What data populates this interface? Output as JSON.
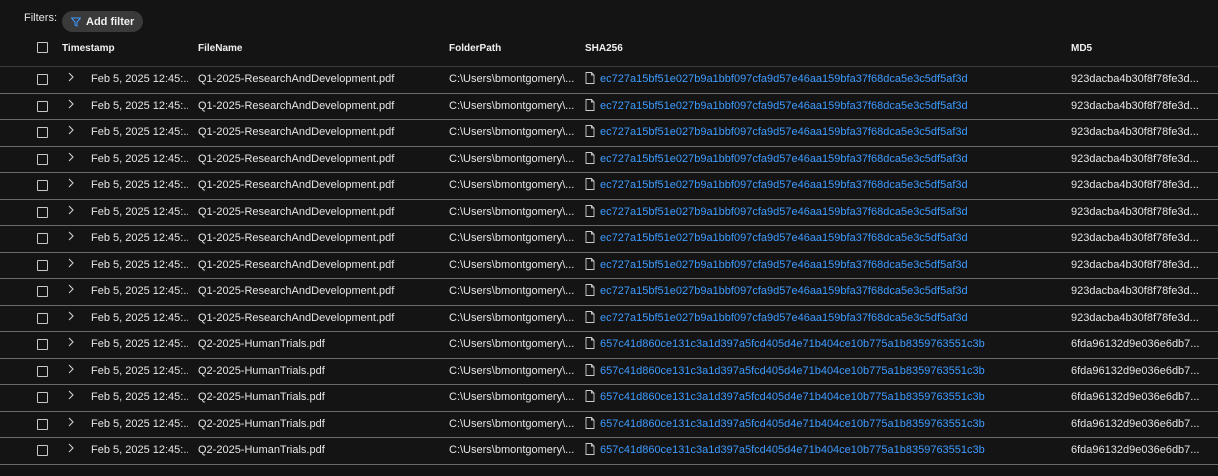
{
  "filters": {
    "label": "Filters:",
    "add_filter_label": "Add filter"
  },
  "columns": {
    "timestamp": "Timestamp",
    "filename": "FileName",
    "folderpath": "FolderPath",
    "sha256": "SHA256",
    "md5": "MD5"
  },
  "rows": [
    {
      "timestamp": "Feb 5, 2025 12:45:...",
      "filename": "Q1-2025-ResearchAndDevelopment.pdf",
      "folderpath": "C:\\Users\\bmontgomery\\...",
      "sha256": "ec727a15bf51e027b9a1bbf097cfa9d57e46aa159bfa37f68dca5e3c5df5af3d",
      "md5": "923dacba4b30f8f78fe3d..."
    },
    {
      "timestamp": "Feb 5, 2025 12:45:...",
      "filename": "Q1-2025-ResearchAndDevelopment.pdf",
      "folderpath": "C:\\Users\\bmontgomery\\...",
      "sha256": "ec727a15bf51e027b9a1bbf097cfa9d57e46aa159bfa37f68dca5e3c5df5af3d",
      "md5": "923dacba4b30f8f78fe3d..."
    },
    {
      "timestamp": "Feb 5, 2025 12:45:...",
      "filename": "Q1-2025-ResearchAndDevelopment.pdf",
      "folderpath": "C:\\Users\\bmontgomery\\...",
      "sha256": "ec727a15bf51e027b9a1bbf097cfa9d57e46aa159bfa37f68dca5e3c5df5af3d",
      "md5": "923dacba4b30f8f78fe3d..."
    },
    {
      "timestamp": "Feb 5, 2025 12:45:...",
      "filename": "Q1-2025-ResearchAndDevelopment.pdf",
      "folderpath": "C:\\Users\\bmontgomery\\...",
      "sha256": "ec727a15bf51e027b9a1bbf097cfa9d57e46aa159bfa37f68dca5e3c5df5af3d",
      "md5": "923dacba4b30f8f78fe3d..."
    },
    {
      "timestamp": "Feb 5, 2025 12:45:...",
      "filename": "Q1-2025-ResearchAndDevelopment.pdf",
      "folderpath": "C:\\Users\\bmontgomery\\...",
      "sha256": "ec727a15bf51e027b9a1bbf097cfa9d57e46aa159bfa37f68dca5e3c5df5af3d",
      "md5": "923dacba4b30f8f78fe3d..."
    },
    {
      "timestamp": "Feb 5, 2025 12:45:...",
      "filename": "Q1-2025-ResearchAndDevelopment.pdf",
      "folderpath": "C:\\Users\\bmontgomery\\...",
      "sha256": "ec727a15bf51e027b9a1bbf097cfa9d57e46aa159bfa37f68dca5e3c5df5af3d",
      "md5": "923dacba4b30f8f78fe3d..."
    },
    {
      "timestamp": "Feb 5, 2025 12:45:...",
      "filename": "Q1-2025-ResearchAndDevelopment.pdf",
      "folderpath": "C:\\Users\\bmontgomery\\...",
      "sha256": "ec727a15bf51e027b9a1bbf097cfa9d57e46aa159bfa37f68dca5e3c5df5af3d",
      "md5": "923dacba4b30f8f78fe3d..."
    },
    {
      "timestamp": "Feb 5, 2025 12:45:...",
      "filename": "Q1-2025-ResearchAndDevelopment.pdf",
      "folderpath": "C:\\Users\\bmontgomery\\...",
      "sha256": "ec727a15bf51e027b9a1bbf097cfa9d57e46aa159bfa37f68dca5e3c5df5af3d",
      "md5": "923dacba4b30f8f78fe3d..."
    },
    {
      "timestamp": "Feb 5, 2025 12:45:...",
      "filename": "Q1-2025-ResearchAndDevelopment.pdf",
      "folderpath": "C:\\Users\\bmontgomery\\...",
      "sha256": "ec727a15bf51e027b9a1bbf097cfa9d57e46aa159bfa37f68dca5e3c5df5af3d",
      "md5": "923dacba4b30f8f78fe3d..."
    },
    {
      "timestamp": "Feb 5, 2025 12:45:...",
      "filename": "Q1-2025-ResearchAndDevelopment.pdf",
      "folderpath": "C:\\Users\\bmontgomery\\...",
      "sha256": "ec727a15bf51e027b9a1bbf097cfa9d57e46aa159bfa37f68dca5e3c5df5af3d",
      "md5": "923dacba4b30f8f78fe3d..."
    },
    {
      "timestamp": "Feb 5, 2025 12:45:...",
      "filename": "Q2-2025-HumanTrials.pdf",
      "folderpath": "C:\\Users\\bmontgomery\\...",
      "sha256": "657c41d860ce131c3a1d397a5fcd405d4e71b404ce10b775a1b8359763551c3b",
      "md5": "6fda96132d9e036e6db7..."
    },
    {
      "timestamp": "Feb 5, 2025 12:45:...",
      "filename": "Q2-2025-HumanTrials.pdf",
      "folderpath": "C:\\Users\\bmontgomery\\...",
      "sha256": "657c41d860ce131c3a1d397a5fcd405d4e71b404ce10b775a1b8359763551c3b",
      "md5": "6fda96132d9e036e6db7..."
    },
    {
      "timestamp": "Feb 5, 2025 12:45:...",
      "filename": "Q2-2025-HumanTrials.pdf",
      "folderpath": "C:\\Users\\bmontgomery\\...",
      "sha256": "657c41d860ce131c3a1d397a5fcd405d4e71b404ce10b775a1b8359763551c3b",
      "md5": "6fda96132d9e036e6db7..."
    },
    {
      "timestamp": "Feb 5, 2025 12:45:...",
      "filename": "Q2-2025-HumanTrials.pdf",
      "folderpath": "C:\\Users\\bmontgomery\\...",
      "sha256": "657c41d860ce131c3a1d397a5fcd405d4e71b404ce10b775a1b8359763551c3b",
      "md5": "6fda96132d9e036e6db7..."
    },
    {
      "timestamp": "Feb 5, 2025 12:45:...",
      "filename": "Q2-2025-HumanTrials.pdf",
      "folderpath": "C:\\Users\\bmontgomery\\...",
      "sha256": "657c41d860ce131c3a1d397a5fcd405d4e71b404ce10b775a1b8359763551c3b",
      "md5": "6fda96132d9e036e6db7..."
    }
  ],
  "colors": {
    "background": "#141414",
    "link": "#3d9bff",
    "row_divider": "#6a6a6a",
    "filter_pill": "#3a3a3a"
  },
  "icons": {
    "add_filter": "filter-icon",
    "row_expand": "chevron-right-icon",
    "hash": "file-icon"
  }
}
